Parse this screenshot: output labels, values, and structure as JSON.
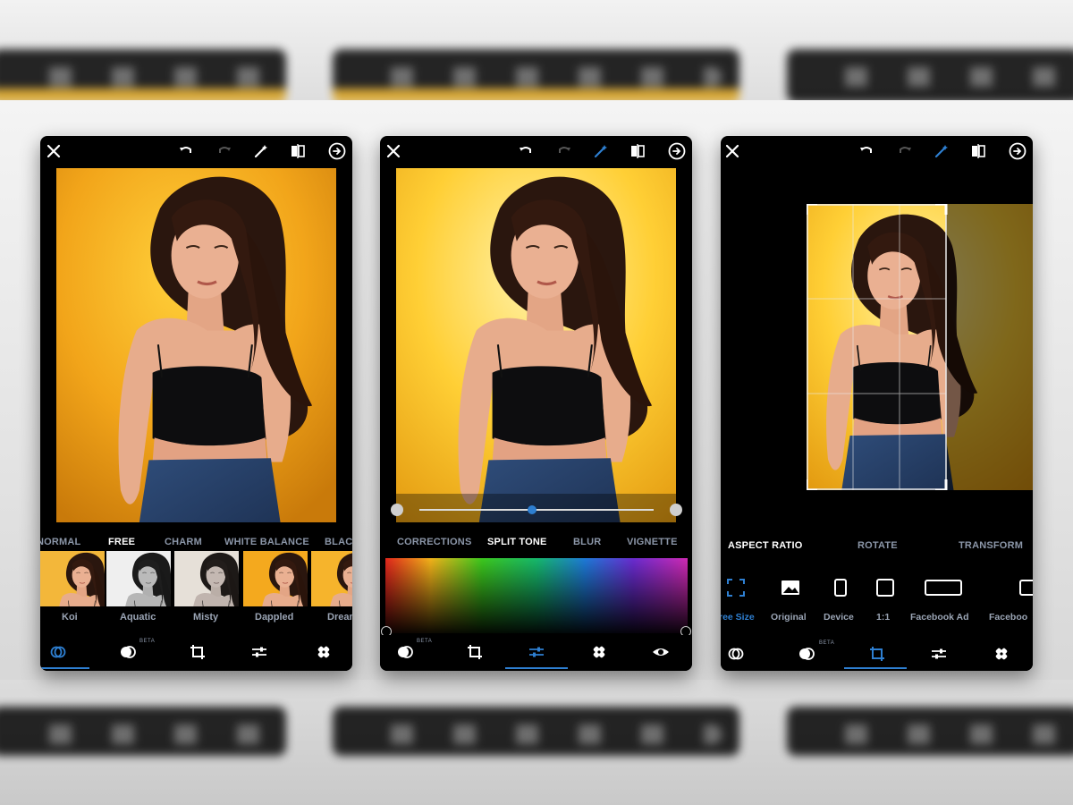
{
  "colors": {
    "accent": "#2e7fd1",
    "wall": "#f0a81e",
    "menu_inactive": "#8b96a8",
    "menu_active": "#ffffff"
  },
  "phone1": {
    "menu": [
      "NORMAL",
      "FREE",
      "CHARM",
      "WHITE BALANCE",
      "BLAC"
    ],
    "active_menu": "FREE",
    "thumbnails": [
      "Koi",
      "Aquatic",
      "Misty",
      "Dappled",
      "Dream"
    ],
    "beta_label": "BETA",
    "top_icons": [
      "close-icon",
      "undo-icon",
      "redo-icon",
      "magic-wand-icon",
      "compare-icon",
      "next-arrow-icon"
    ],
    "bottom_icons": [
      "looks-icon",
      "blend-icon",
      "crop-icon",
      "adjust-icon",
      "heal-icon"
    ]
  },
  "phone2": {
    "menu": [
      "CORRECTIONS",
      "SPLIT TONE",
      "BLUR",
      "VIGNETTE"
    ],
    "active_menu": "SPLIT TONE",
    "slider_value": 0.48,
    "beta_label": "BETA",
    "top_icons": [
      "close-icon",
      "undo-icon",
      "redo-icon",
      "magic-wand-icon",
      "compare-icon",
      "next-arrow-icon"
    ],
    "bottom_icons": [
      "blend-icon",
      "crop-icon",
      "adjust-icon",
      "heal-icon",
      "eye-icon"
    ]
  },
  "phone3": {
    "menu": [
      "ASPECT RATIO",
      "ROTATE",
      "TRANSFORM"
    ],
    "active_menu": "ASPECT RATIO",
    "aspect_options": [
      "ree Size",
      "Original",
      "Device",
      "1:1",
      "Facebook Ad",
      "Faceboo"
    ],
    "beta_label": "BETA",
    "top_icons": [
      "close-icon",
      "undo-icon",
      "redo-icon",
      "magic-wand-icon",
      "compare-icon",
      "next-arrow-icon"
    ],
    "bottom_icons": [
      "looks-icon",
      "blend-icon",
      "crop-icon",
      "adjust-icon",
      "heal-icon"
    ]
  }
}
